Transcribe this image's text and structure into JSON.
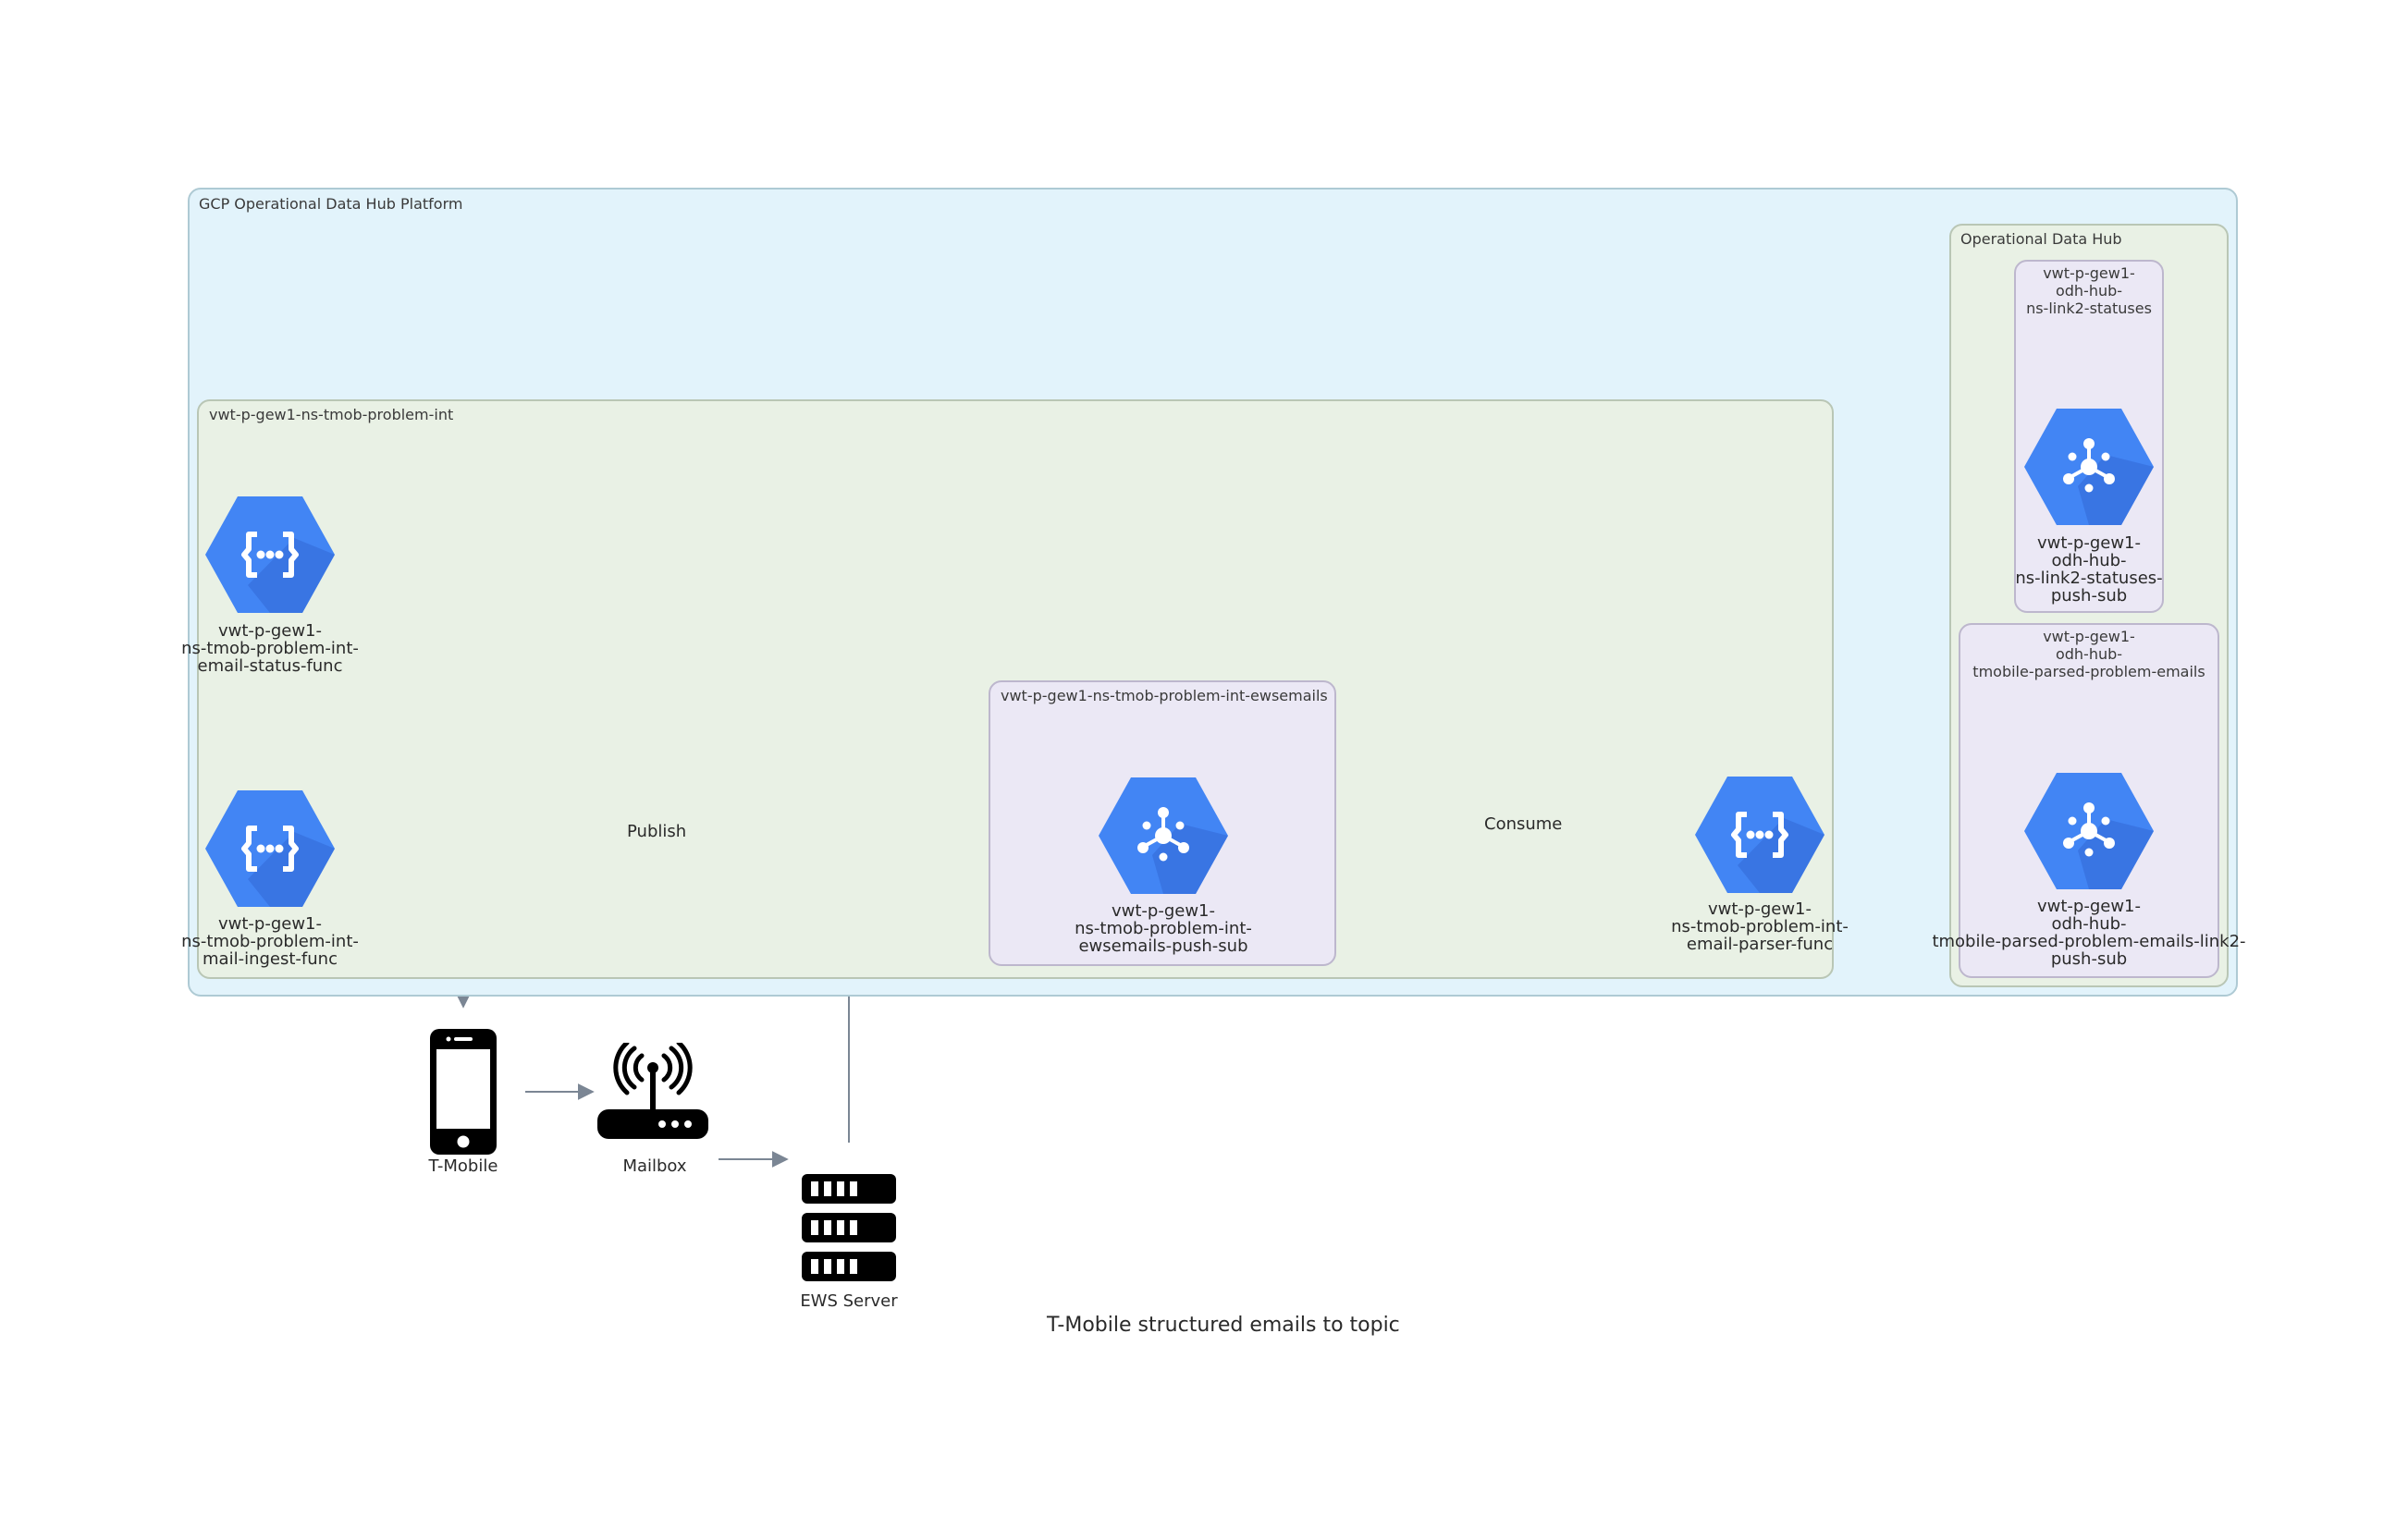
{
  "diagram": {
    "caption": "T-Mobile structured emails to topic",
    "clusters": {
      "platform": "GCP Operational Data Hub Platform",
      "problem_int": "vwt-p-gew1-ns-tmob-problem-int",
      "ewsemails": "vwt-p-gew1-ns-tmob-problem-int-ewsemails",
      "odh": "Operational Data Hub",
      "statuses": "vwt-p-gew1-\nodh-hub-\nns-link2-statuses",
      "parsed": "vwt-p-gew1-\nodh-hub-\ntmobile-parsed-problem-emails"
    },
    "nodes": {
      "status_func": {
        "label": "vwt-p-gew1-\nns-tmob-problem-int-\nemail-status-func",
        "icon": "cloud-functions-icon"
      },
      "ingest_func": {
        "label": "vwt-p-gew1-\nns-tmob-problem-int-\nmail-ingest-func",
        "icon": "cloud-functions-icon"
      },
      "ewsemails_sub": {
        "label": "vwt-p-gew1-\nns-tmob-problem-int-\newsemails-push-sub",
        "icon": "pubsub-icon"
      },
      "parser_func": {
        "label": "vwt-p-gew1-\nns-tmob-problem-int-\nemail-parser-func",
        "icon": "cloud-functions-icon"
      },
      "statuses_sub": {
        "label": "vwt-p-gew1-\nodh-hub-\nns-link2-statuses-\npush-sub",
        "icon": "pubsub-icon"
      },
      "parsed_sub": {
        "label": "vwt-p-gew1-\nodh-hub-\ntmobile-parsed-problem-emails-link2-\npush-sub",
        "icon": "pubsub-icon"
      },
      "tmobile": {
        "label": "T-Mobile",
        "icon": "mobile-phone-icon"
      },
      "mailbox": {
        "label": "Mailbox",
        "icon": "router-icon"
      },
      "ews_server": {
        "label": "EWS Server",
        "icon": "server-icon"
      }
    },
    "edges": {
      "publish": "Publish",
      "consume": "Consume"
    },
    "colors": {
      "platform_fill": "#e2f3fb",
      "namespace_fill": "#e9f1e5",
      "topic_fill": "#ebe8f5",
      "gcp_blue": "#4285f4",
      "gcp_shadow": "#3367d6",
      "edge": "#7b8694"
    }
  }
}
